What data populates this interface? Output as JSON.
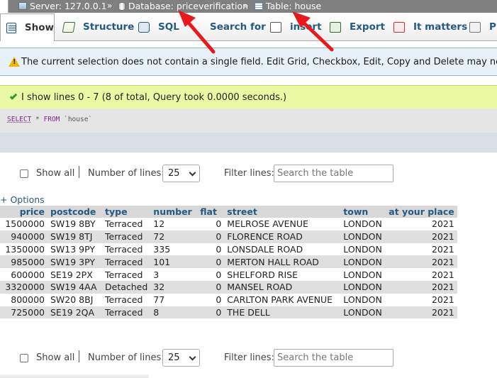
{
  "breadcrumb": {
    "server": "Server: 127.0.0.1",
    "database": "Database: priceverification",
    "table": "Table: house",
    "separator": "»"
  },
  "tabs": [
    {
      "label": "Show",
      "icon": "browse-icon",
      "active": true
    },
    {
      "label": "Structure",
      "icon": "structure-icon"
    },
    {
      "label": "SQL",
      "icon": "sql-icon"
    },
    {
      "label": "Search for",
      "icon": "search-icon"
    },
    {
      "label": "insert",
      "icon": "insert-icon"
    },
    {
      "label": "Export",
      "icon": "export-icon"
    },
    {
      "label": "It matters",
      "icon": "import-icon"
    },
    {
      "label": "Pr",
      "icon": "privileges-icon"
    }
  ],
  "notice": {
    "text": "The current selection does not contain a single field. Edit Grid, Checkbox, Edit, Copy and Delete may not be availab"
  },
  "success": {
    "text": "I show lines 0 - 7 (8 of total, Query took 0.0000 seconds.)"
  },
  "query": {
    "select": "SELECT",
    "star": " * ",
    "from": "FROM",
    "table": " `house`"
  },
  "nav": {
    "show_all": "Show all",
    "number_of_lines": "Number of lines:",
    "lines_value": "25",
    "filter_label": "Filter lines:",
    "filter_placeholder": "Search the table"
  },
  "options_link": "+ Options",
  "table": {
    "columns": [
      "price",
      "postcode",
      "type",
      "number",
      "flat",
      "street",
      "town",
      "at your place"
    ],
    "rows": [
      [
        "1500000",
        "SW19 8BY",
        "Terraced",
        "12",
        "0",
        "MELROSE AVENUE",
        "LONDON",
        "2021"
      ],
      [
        "940000",
        "SW19 8TJ",
        "Terraced",
        "72",
        "0",
        "FLORENCE ROAD",
        "LONDON",
        "2021"
      ],
      [
        "1350000",
        "SW13 9PY",
        "Terraced",
        "335",
        "0",
        "LONSDALE ROAD",
        "LONDON",
        "2021"
      ],
      [
        "985000",
        "SW19 3PY",
        "Terraced",
        "101",
        "0",
        "MERTON HALL ROAD",
        "LONDON",
        "2021"
      ],
      [
        "600000",
        "SE19 2PX",
        "Terraced",
        "3",
        "0",
        "SHELFORD RISE",
        "LONDON",
        "2021"
      ],
      [
        "3320000",
        "SW19 4AA",
        "Detached",
        "32",
        "0",
        "MANSEL ROAD",
        "LONDON",
        "2021"
      ],
      [
        "800000",
        "SW20 8BJ",
        "Terraced",
        "77",
        "0",
        "CARLTON PARK AVENUE",
        "LONDON",
        "2021"
      ],
      [
        "725000",
        "SE19 2QA",
        "Terraced",
        "8",
        "0",
        "THE DELL",
        "LONDON",
        "2021"
      ]
    ]
  },
  "colors": {
    "link": "#235a81",
    "notice_bg": "#e7f1f9",
    "success_bg": "#ebf8a4",
    "arrow": "#e8191c"
  }
}
